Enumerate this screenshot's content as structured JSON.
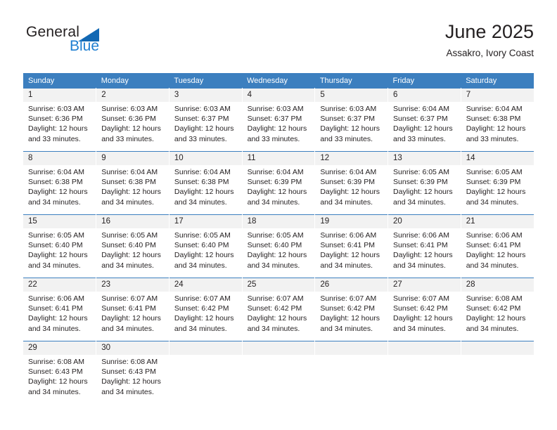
{
  "brand": {
    "name_part1": "General",
    "name_part2": "Blue",
    "triangle_color": "#1268b3",
    "blue_color": "#1f7fd1"
  },
  "header": {
    "title": "June 2025",
    "subtitle": "Assakro, Ivory Coast"
  },
  "theme": {
    "header_bg": "#3c7fbf",
    "daynum_bg": "#f2f2f2",
    "text": "#231f20",
    "cell_bg": "#ffffff"
  },
  "weekdays": [
    "Sunday",
    "Monday",
    "Tuesday",
    "Wednesday",
    "Thursday",
    "Friday",
    "Saturday"
  ],
  "labels": {
    "sunrise_prefix": "Sunrise:",
    "sunset_prefix": "Sunset:",
    "daylight_prefix": "Daylight:"
  },
  "weeks": [
    [
      {
        "day": "1",
        "sunrise": "Sunrise: 6:03 AM",
        "sunset": "Sunset: 6:36 PM",
        "daylight1": "Daylight: 12 hours",
        "daylight2": "and 33 minutes."
      },
      {
        "day": "2",
        "sunrise": "Sunrise: 6:03 AM",
        "sunset": "Sunset: 6:36 PM",
        "daylight1": "Daylight: 12 hours",
        "daylight2": "and 33 minutes."
      },
      {
        "day": "3",
        "sunrise": "Sunrise: 6:03 AM",
        "sunset": "Sunset: 6:37 PM",
        "daylight1": "Daylight: 12 hours",
        "daylight2": "and 33 minutes."
      },
      {
        "day": "4",
        "sunrise": "Sunrise: 6:03 AM",
        "sunset": "Sunset: 6:37 PM",
        "daylight1": "Daylight: 12 hours",
        "daylight2": "and 33 minutes."
      },
      {
        "day": "5",
        "sunrise": "Sunrise: 6:03 AM",
        "sunset": "Sunset: 6:37 PM",
        "daylight1": "Daylight: 12 hours",
        "daylight2": "and 33 minutes."
      },
      {
        "day": "6",
        "sunrise": "Sunrise: 6:04 AM",
        "sunset": "Sunset: 6:37 PM",
        "daylight1": "Daylight: 12 hours",
        "daylight2": "and 33 minutes."
      },
      {
        "day": "7",
        "sunrise": "Sunrise: 6:04 AM",
        "sunset": "Sunset: 6:38 PM",
        "daylight1": "Daylight: 12 hours",
        "daylight2": "and 33 minutes."
      }
    ],
    [
      {
        "day": "8",
        "sunrise": "Sunrise: 6:04 AM",
        "sunset": "Sunset: 6:38 PM",
        "daylight1": "Daylight: 12 hours",
        "daylight2": "and 34 minutes."
      },
      {
        "day": "9",
        "sunrise": "Sunrise: 6:04 AM",
        "sunset": "Sunset: 6:38 PM",
        "daylight1": "Daylight: 12 hours",
        "daylight2": "and 34 minutes."
      },
      {
        "day": "10",
        "sunrise": "Sunrise: 6:04 AM",
        "sunset": "Sunset: 6:38 PM",
        "daylight1": "Daylight: 12 hours",
        "daylight2": "and 34 minutes."
      },
      {
        "day": "11",
        "sunrise": "Sunrise: 6:04 AM",
        "sunset": "Sunset: 6:39 PM",
        "daylight1": "Daylight: 12 hours",
        "daylight2": "and 34 minutes."
      },
      {
        "day": "12",
        "sunrise": "Sunrise: 6:04 AM",
        "sunset": "Sunset: 6:39 PM",
        "daylight1": "Daylight: 12 hours",
        "daylight2": "and 34 minutes."
      },
      {
        "day": "13",
        "sunrise": "Sunrise: 6:05 AM",
        "sunset": "Sunset: 6:39 PM",
        "daylight1": "Daylight: 12 hours",
        "daylight2": "and 34 minutes."
      },
      {
        "day": "14",
        "sunrise": "Sunrise: 6:05 AM",
        "sunset": "Sunset: 6:39 PM",
        "daylight1": "Daylight: 12 hours",
        "daylight2": "and 34 minutes."
      }
    ],
    [
      {
        "day": "15",
        "sunrise": "Sunrise: 6:05 AM",
        "sunset": "Sunset: 6:40 PM",
        "daylight1": "Daylight: 12 hours",
        "daylight2": "and 34 minutes."
      },
      {
        "day": "16",
        "sunrise": "Sunrise: 6:05 AM",
        "sunset": "Sunset: 6:40 PM",
        "daylight1": "Daylight: 12 hours",
        "daylight2": "and 34 minutes."
      },
      {
        "day": "17",
        "sunrise": "Sunrise: 6:05 AM",
        "sunset": "Sunset: 6:40 PM",
        "daylight1": "Daylight: 12 hours",
        "daylight2": "and 34 minutes."
      },
      {
        "day": "18",
        "sunrise": "Sunrise: 6:05 AM",
        "sunset": "Sunset: 6:40 PM",
        "daylight1": "Daylight: 12 hours",
        "daylight2": "and 34 minutes."
      },
      {
        "day": "19",
        "sunrise": "Sunrise: 6:06 AM",
        "sunset": "Sunset: 6:41 PM",
        "daylight1": "Daylight: 12 hours",
        "daylight2": "and 34 minutes."
      },
      {
        "day": "20",
        "sunrise": "Sunrise: 6:06 AM",
        "sunset": "Sunset: 6:41 PM",
        "daylight1": "Daylight: 12 hours",
        "daylight2": "and 34 minutes."
      },
      {
        "day": "21",
        "sunrise": "Sunrise: 6:06 AM",
        "sunset": "Sunset: 6:41 PM",
        "daylight1": "Daylight: 12 hours",
        "daylight2": "and 34 minutes."
      }
    ],
    [
      {
        "day": "22",
        "sunrise": "Sunrise: 6:06 AM",
        "sunset": "Sunset: 6:41 PM",
        "daylight1": "Daylight: 12 hours",
        "daylight2": "and 34 minutes."
      },
      {
        "day": "23",
        "sunrise": "Sunrise: 6:07 AM",
        "sunset": "Sunset: 6:41 PM",
        "daylight1": "Daylight: 12 hours",
        "daylight2": "and 34 minutes."
      },
      {
        "day": "24",
        "sunrise": "Sunrise: 6:07 AM",
        "sunset": "Sunset: 6:42 PM",
        "daylight1": "Daylight: 12 hours",
        "daylight2": "and 34 minutes."
      },
      {
        "day": "25",
        "sunrise": "Sunrise: 6:07 AM",
        "sunset": "Sunset: 6:42 PM",
        "daylight1": "Daylight: 12 hours",
        "daylight2": "and 34 minutes."
      },
      {
        "day": "26",
        "sunrise": "Sunrise: 6:07 AM",
        "sunset": "Sunset: 6:42 PM",
        "daylight1": "Daylight: 12 hours",
        "daylight2": "and 34 minutes."
      },
      {
        "day": "27",
        "sunrise": "Sunrise: 6:07 AM",
        "sunset": "Sunset: 6:42 PM",
        "daylight1": "Daylight: 12 hours",
        "daylight2": "and 34 minutes."
      },
      {
        "day": "28",
        "sunrise": "Sunrise: 6:08 AM",
        "sunset": "Sunset: 6:42 PM",
        "daylight1": "Daylight: 12 hours",
        "daylight2": "and 34 minutes."
      }
    ],
    [
      {
        "day": "29",
        "sunrise": "Sunrise: 6:08 AM",
        "sunset": "Sunset: 6:43 PM",
        "daylight1": "Daylight: 12 hours",
        "daylight2": "and 34 minutes."
      },
      {
        "day": "30",
        "sunrise": "Sunrise: 6:08 AM",
        "sunset": "Sunset: 6:43 PM",
        "daylight1": "Daylight: 12 hours",
        "daylight2": "and 34 minutes."
      },
      {
        "day": "",
        "sunrise": "",
        "sunset": "",
        "daylight1": "",
        "daylight2": ""
      },
      {
        "day": "",
        "sunrise": "",
        "sunset": "",
        "daylight1": "",
        "daylight2": ""
      },
      {
        "day": "",
        "sunrise": "",
        "sunset": "",
        "daylight1": "",
        "daylight2": ""
      },
      {
        "day": "",
        "sunrise": "",
        "sunset": "",
        "daylight1": "",
        "daylight2": ""
      },
      {
        "day": "",
        "sunrise": "",
        "sunset": "",
        "daylight1": "",
        "daylight2": ""
      }
    ]
  ]
}
